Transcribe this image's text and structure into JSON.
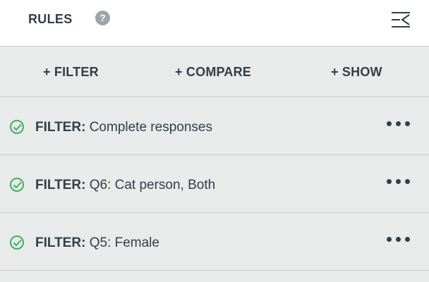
{
  "header": {
    "title": "RULES",
    "help_glyph": "?",
    "help_icon": "help-circle-icon",
    "collapse_icon": "collapse-panel-icon"
  },
  "actions": [
    {
      "label": "+ FILTER"
    },
    {
      "label": "+ COMPARE"
    },
    {
      "label": "+ SHOW"
    }
  ],
  "rules": [
    {
      "kind": "FILTER:",
      "text": "Complete responses",
      "status_icon": "check-circle-icon",
      "menu_icon": "more-options-icon"
    },
    {
      "kind": "FILTER:",
      "text": "Q6: Cat person, Both",
      "status_icon": "check-circle-icon",
      "menu_icon": "more-options-icon"
    },
    {
      "kind": "FILTER:",
      "text": "Q5: Female",
      "status_icon": "check-circle-icon",
      "menu_icon": "more-options-icon"
    }
  ],
  "colors": {
    "accent_green": "#3fb062",
    "text": "#333e48",
    "panel_bg": "#e9eaea",
    "header_bg": "#ffffff",
    "divider": "#c9cccf",
    "help_bg": "#9da5ab"
  }
}
